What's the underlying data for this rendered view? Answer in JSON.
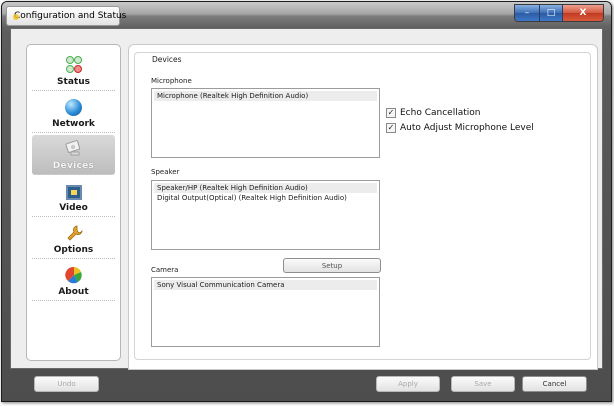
{
  "window": {
    "title": "Configuration and Status",
    "controls": {
      "minimize": "–",
      "maximize": "□",
      "close": "X"
    }
  },
  "sidebar": {
    "items": [
      {
        "label": "Status",
        "icon": "status-lights-icon",
        "active": false
      },
      {
        "label": "Network",
        "icon": "globe-icon",
        "active": false
      },
      {
        "label": "Devices",
        "icon": "devices-icon",
        "active": true
      },
      {
        "label": "Video",
        "icon": "video-icon",
        "active": false
      },
      {
        "label": "Options",
        "icon": "wrench-icon",
        "active": false
      },
      {
        "label": "About",
        "icon": "about-icon",
        "active": false
      }
    ]
  },
  "devices": {
    "group_title": "Devices",
    "microphone": {
      "label": "Microphone",
      "items": [
        "Microphone (Realtek High Definition Audio)"
      ]
    },
    "speaker": {
      "label": "Speaker",
      "items": [
        "Speaker/HP (Realtek High Definition Audio)",
        "Digital Output(Optical) (Realtek High Definition Audio)"
      ]
    },
    "camera": {
      "label": "Camera",
      "setup_label": "Setup",
      "items": [
        "Sony Visual Communication Camera"
      ]
    },
    "options": {
      "echo_cancellation": {
        "label": "Echo Cancellation",
        "checked": true
      },
      "auto_adjust_mic": {
        "label": "Auto Adjust Microphone Level",
        "checked": true
      }
    }
  },
  "footer": {
    "undo_label": "Undo",
    "apply_label": "Apply",
    "save_label": "Save",
    "cancel_label": "Cancel"
  }
}
